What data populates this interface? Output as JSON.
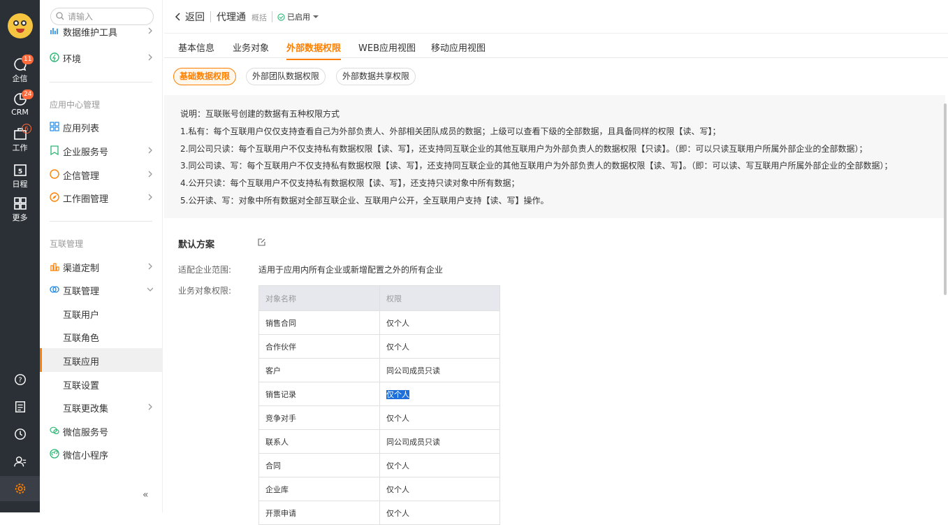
{
  "rail": {
    "items": [
      {
        "label": "企信",
        "badge": "11"
      },
      {
        "label": "CRM",
        "badge": "24"
      },
      {
        "label": "工作",
        "badge": "6"
      },
      {
        "label": "日程",
        "day": "5"
      },
      {
        "label": "更多"
      }
    ]
  },
  "sidebar": {
    "search_placeholder": "请输入",
    "top_items": [
      {
        "label": "数据维护工具"
      },
      {
        "label": "环境"
      }
    ],
    "section1_title": "应用中心管理",
    "section1_items": [
      {
        "label": "应用列表"
      },
      {
        "label": "企业服务号"
      },
      {
        "label": "企信管理"
      },
      {
        "label": "工作圈管理"
      }
    ],
    "section2_title": "互联管理",
    "section2_items": [
      {
        "label": "渠道定制"
      },
      {
        "label": "互联管理"
      },
      {
        "label": "互联用户"
      },
      {
        "label": "互联角色"
      },
      {
        "label": "互联应用"
      },
      {
        "label": "互联设置"
      },
      {
        "label": "互联更改集"
      },
      {
        "label": "微信服务号"
      },
      {
        "label": "微信小程序"
      }
    ],
    "collapse_label": "«"
  },
  "header": {
    "back_label": "返回",
    "title": "代理通",
    "subtitle": "概括",
    "status": "已启用"
  },
  "tabs": [
    {
      "label": "基本信息"
    },
    {
      "label": "业务对象"
    },
    {
      "label": "外部数据权限"
    },
    {
      "label": "WEB应用视图"
    },
    {
      "label": "移动应用视图"
    }
  ],
  "subtabs": [
    {
      "label": "基础数据权限"
    },
    {
      "label": "外部团队数据权限"
    },
    {
      "label": "外部数据共享权限"
    }
  ],
  "description": {
    "heading": "说明：互联账号创建的数据有五种权限方式",
    "lines": [
      "1.私有：每个互联用户仅仅支持查看自己为外部负责人、外部相关团队成员的数据；上级可以查看下级的全部数据，且具备同样的权限【读、写】；",
      "2.同公司只读：每个互联用户不仅支持私有数据权限【读、写】，还支持同互联企业的其他互联用户为外部负责人的数据权限【只读】。（即：可以只读互联用户所属外部企业的全部数据）；",
      "3.同公司读、写：每个互联用户不仅支持私有数据权限【读、写】，还支持同互联企业的其他互联用户为外部负责人的数据权限【读、写】。（即：可以读、写互联用户所属外部企业的全部数据）；",
      "4.公开只读：每个互联用户不仅支持私有数据权限【读、写】，还支持只读对象中所有数据；",
      "5.公开读、写：对象中所有数据对全部互联企业、互联用户公开，全互联用户支持【读、写】操作。"
    ]
  },
  "scheme": {
    "title": "默认方案",
    "scope_label": "适配企业范围:",
    "scope_value": "适用于应用内所有企业或新增配置之外的所有企业",
    "perm_label": "业务对象权限:",
    "columns": [
      "对象名称",
      "权限"
    ],
    "rows": [
      [
        "销售合同",
        "仅个人"
      ],
      [
        "合作伙伴",
        "仅个人"
      ],
      [
        "客户",
        "同公司成员只读"
      ],
      [
        "销售记录",
        "仅个人"
      ],
      [
        "竞争对手",
        "仅个人"
      ],
      [
        "联系人",
        "同公司成员只读"
      ],
      [
        "合同",
        "仅个人"
      ],
      [
        "企业库",
        "仅个人"
      ],
      [
        "开票申请",
        "仅个人"
      ]
    ]
  },
  "colors": {
    "accent": "#ff8000",
    "rail": "#2b2f36",
    "selection": "#1e6fd9"
  }
}
